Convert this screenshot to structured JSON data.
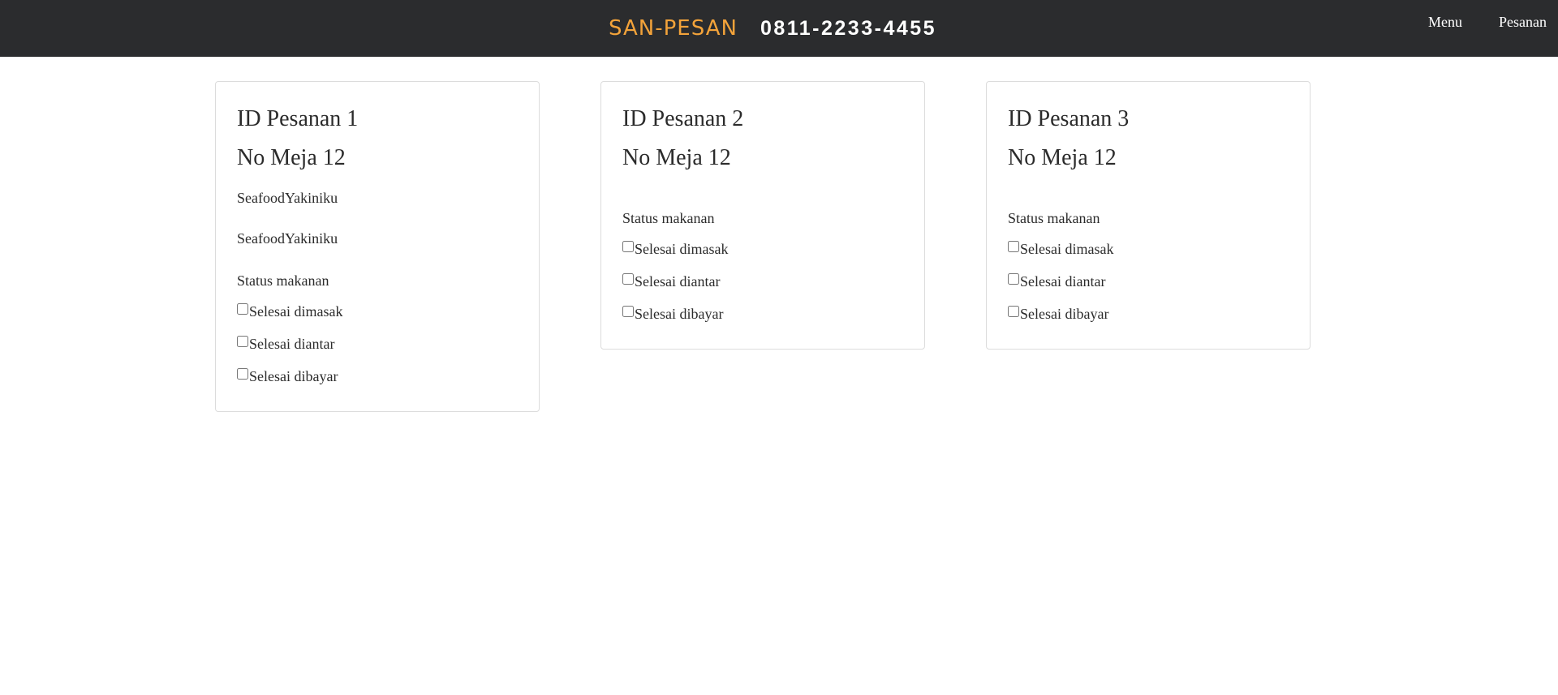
{
  "header": {
    "brand": "SAN-PESAN",
    "phone": "0811-2233-4455",
    "nav": {
      "menu": "Menu",
      "orders": "Pesanan"
    }
  },
  "orders": [
    {
      "order_id": "ID Pesanan 1",
      "table": "No Meja 12",
      "items": [
        "SeafoodYakiniku",
        "SeafoodYakiniku"
      ],
      "status_label": "Status makanan",
      "checks": [
        {
          "label": "Selesai dimasak",
          "checked": false
        },
        {
          "label": "Selesai diantar",
          "checked": false
        },
        {
          "label": "Selesai dibayar",
          "checked": false
        }
      ]
    },
    {
      "order_id": "ID Pesanan 2",
      "table": "No Meja 12",
      "items": [],
      "status_label": "Status makanan",
      "checks": [
        {
          "label": "Selesai dimasak",
          "checked": false
        },
        {
          "label": "Selesai diantar",
          "checked": false
        },
        {
          "label": "Selesai dibayar",
          "checked": false
        }
      ]
    },
    {
      "order_id": "ID Pesanan 3",
      "table": "No Meja 12",
      "items": [],
      "status_label": "Status makanan",
      "checks": [
        {
          "label": "Selesai dimasak",
          "checked": false
        },
        {
          "label": "Selesai diantar",
          "checked": false
        },
        {
          "label": "Selesai dibayar",
          "checked": false
        }
      ]
    }
  ],
  "colors": {
    "navbar_bg": "#2b2c2e",
    "brand": "#f3a33a",
    "card_border": "#dcdcdc"
  }
}
